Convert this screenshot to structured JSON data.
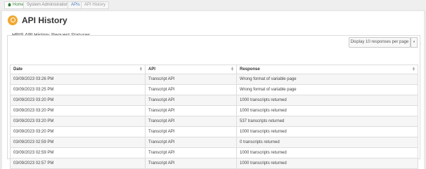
{
  "breadcrumb": {
    "items": [
      {
        "label": "Home"
      },
      {
        "label": "System Administration"
      },
      {
        "label": "APIs"
      },
      {
        "label": "API History"
      }
    ]
  },
  "header": {
    "title": "API History",
    "icon": "api-history-icon"
  },
  "tabs": [
    {
      "label": "HRIS API History",
      "active": false
    },
    {
      "label": "Request Statuses",
      "active": true
    }
  ],
  "controls": {
    "page_size_select": "Display 10 responses per page"
  },
  "table": {
    "columns": [
      "Date",
      "API",
      "Response"
    ],
    "rows": [
      {
        "date": "03/09/2023 03:26 PM",
        "api": "Transcript API",
        "response": "Wrong format of variable page"
      },
      {
        "date": "03/09/2023 03:25 PM",
        "api": "Transcript API",
        "response": "Wrong format of variable page"
      },
      {
        "date": "03/09/2023 03:20 PM",
        "api": "Transcript API",
        "response": "1000 transcripts returned"
      },
      {
        "date": "03/09/2023 03:20 PM",
        "api": "Transcript API",
        "response": "1000 transcripts returned"
      },
      {
        "date": "03/09/2023 03:20 PM",
        "api": "Transcript API",
        "response": "537 transcripts returned"
      },
      {
        "date": "03/09/2023 03:20 PM",
        "api": "Transcript API",
        "response": "1000 transcripts returned"
      },
      {
        "date": "03/09/2023 02:59 PM",
        "api": "Transcript API",
        "response": "0 transcripts returned"
      },
      {
        "date": "03/09/2023 02:59 PM",
        "api": "Transcript API",
        "response": "1000 transcripts returned"
      },
      {
        "date": "03/09/2023 02:57 PM",
        "api": "Transcript API",
        "response": "1000 transcripts returned"
      }
    ]
  },
  "colors": {
    "accent": "#2e7d32",
    "title_icon": "#f0a830"
  }
}
